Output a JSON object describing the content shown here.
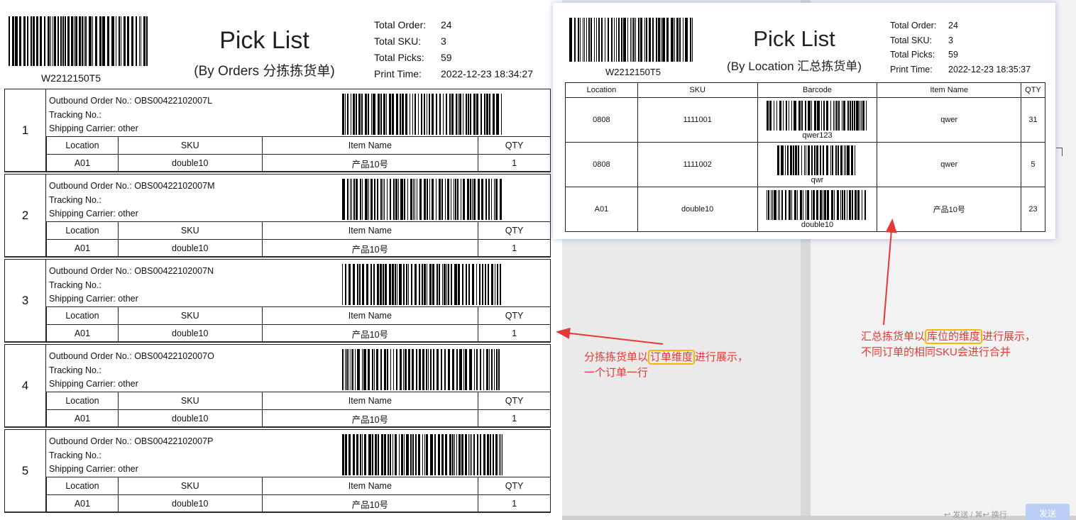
{
  "left": {
    "barcode_text": "W2212150T5",
    "title": "Pick List",
    "subtitle": "(By Orders 分拣拣货单)",
    "stats": [
      {
        "label": "Total Order:",
        "value": "24"
      },
      {
        "label": "Total SKU:",
        "value": "3"
      },
      {
        "label": "Total Picks:",
        "value": "59"
      },
      {
        "label": "Print Time:",
        "value": "2022-12-23 18:34:27"
      }
    ],
    "columns": [
      "Location",
      "SKU",
      "Item Name",
      "QTY"
    ],
    "orders": [
      {
        "num": "1",
        "order_line": "Outbound Order No.: OBS00422102007L",
        "tracking": "Tracking No.:",
        "carrier": "Shipping Carrier: other",
        "row": [
          "A01",
          "double10",
          "产品10号",
          "1"
        ]
      },
      {
        "num": "2",
        "order_line": "Outbound Order No.: OBS00422102007M",
        "tracking": "Tracking No.:",
        "carrier": "Shipping Carrier: other",
        "row": [
          "A01",
          "double10",
          "产品10号",
          "1"
        ]
      },
      {
        "num": "3",
        "order_line": "Outbound Order No.: OBS00422102007N",
        "tracking": "Tracking No.:",
        "carrier": "Shipping Carrier: other",
        "row": [
          "A01",
          "double10",
          "产品10号",
          "1"
        ]
      },
      {
        "num": "4",
        "order_line": "Outbound Order No.: OBS00422102007O",
        "tracking": "Tracking No.:",
        "carrier": "Shipping Carrier: other",
        "row": [
          "A01",
          "double10",
          "产品10号",
          "1"
        ]
      },
      {
        "num": "5",
        "order_line": "Outbound Order No.: OBS00422102007P",
        "tracking": "Tracking No.:",
        "carrier": "Shipping Carrier: other",
        "row": [
          "A01",
          "double10",
          "产品10号",
          "1"
        ]
      }
    ]
  },
  "right": {
    "barcode_text": "W2212150T5",
    "title": "Pick List",
    "subtitle": "(By Location 汇总拣货单)",
    "stats": [
      {
        "label": "Total Order:",
        "value": "24"
      },
      {
        "label": "Total SKU:",
        "value": "3"
      },
      {
        "label": "Total Picks:",
        "value": "59"
      },
      {
        "label": "Print Time:",
        "value": "2022-12-23 18:35:37"
      }
    ],
    "columns": [
      "Location",
      "SKU",
      "Barcode",
      "Item Name",
      "QTY"
    ],
    "rows": [
      {
        "location": "0808",
        "sku": "1111001",
        "barcode": "qwer123",
        "item": "qwer",
        "qty": "31"
      },
      {
        "location": "0808",
        "sku": "1111002",
        "barcode": "qwr",
        "item": "qwer",
        "qty": "5"
      },
      {
        "location": "A01",
        "sku": "double10",
        "barcode": "double10",
        "item": "产品10号",
        "qty": "23"
      }
    ]
  },
  "annotations": {
    "left_a": "分拣拣货单以",
    "left_hl": "订单维度",
    "left_b": "进行展示，",
    "left_line2": "一个订单一行",
    "right_a": "汇总拣货单以",
    "right_hl": "库位的维度",
    "right_b": "进行展示，",
    "right_line2": "不同订单的相同SKU会进行合并"
  },
  "footer": {
    "hint": "↩ 发送 / ⌘↩ 换行",
    "send": "发送"
  },
  "colors": {
    "annotation": "#e53935",
    "highlight": "#f5b800"
  }
}
